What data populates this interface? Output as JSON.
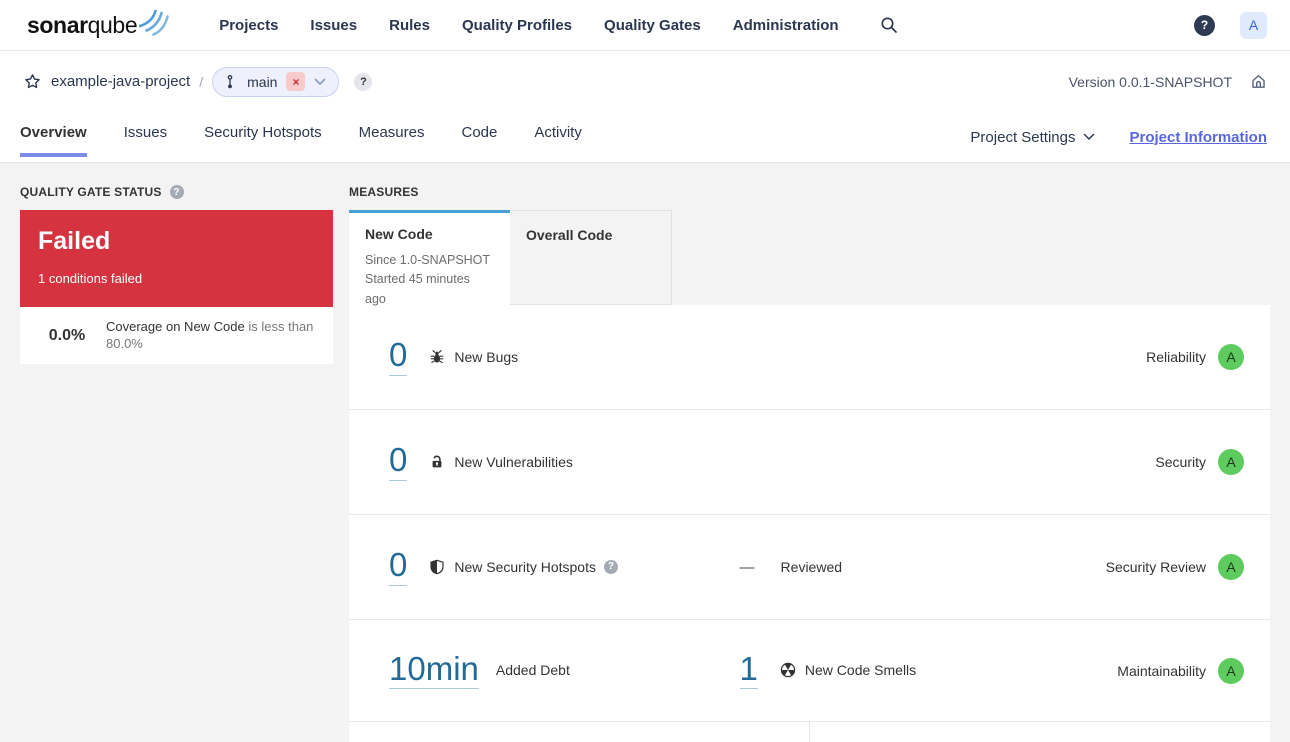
{
  "brand": {
    "name_bold": "sonar",
    "name_rest": "qube"
  },
  "nav": {
    "items": [
      "Projects",
      "Issues",
      "Rules",
      "Quality Profiles",
      "Quality Gates",
      "Administration"
    ],
    "help_glyph": "?",
    "avatar_initial": "A"
  },
  "breadcrumb": {
    "project": "example-java-project",
    "separator": "/",
    "branch_name": "main",
    "remove_glyph": "×",
    "help_glyph": "?",
    "version_label": "Version 0.0.1-SNAPSHOT"
  },
  "tabs": {
    "items": [
      "Overview",
      "Issues",
      "Security Hotspots",
      "Measures",
      "Code",
      "Activity"
    ],
    "active": "Overview",
    "project_settings_label": "Project Settings",
    "project_information_label": "Project Information"
  },
  "quality_gate": {
    "section_title": "QUALITY GATE STATUS",
    "help_glyph": "?",
    "status": "Failed",
    "conditions_summary": "1 conditions failed",
    "condition": {
      "value": "0.0%",
      "metric": "Coverage on New Code",
      "rule": "is less than 80.0%"
    }
  },
  "measures": {
    "section_title": "MEASURES",
    "new_code_tab": {
      "label": "New Code",
      "since": "Since 1.0-SNAPSHOT",
      "started": "Started 45 minutes ago"
    },
    "overall_code_tab": {
      "label": "Overall Code"
    },
    "rows": [
      {
        "value": "0",
        "label": "New Bugs",
        "domain": "Reliability",
        "rating": "A"
      },
      {
        "value": "0",
        "label": "New Vulnerabilities",
        "domain": "Security",
        "rating": "A"
      },
      {
        "value": "0",
        "label": "New Security Hotspots",
        "help_glyph": "?",
        "reviewed_dash": "—",
        "reviewed_label": "Reviewed",
        "domain": "Security Review",
        "rating": "A"
      },
      {
        "value": "10min",
        "label": "Added Debt",
        "smells_value": "1",
        "smells_label": "New Code Smells",
        "domain": "Maintainability",
        "rating": "A"
      }
    ]
  },
  "icons": {
    "search": "magnifier",
    "help": "question-circle",
    "star": "star-outline",
    "branch": "git-branch",
    "chevron": "chevron-down",
    "home": "house-outline",
    "bug": "bug",
    "vulnerability": "open-lock",
    "hotspot": "half-shield",
    "code_smell": "segmented-wheel"
  },
  "colors": {
    "accent_indigo": "#5867dd",
    "link_blue": "#236a97",
    "new_code_tab_blue": "#4b9fd5",
    "failed_red": "#d4333f",
    "rating_a_green": "#5ecb5e",
    "page_background": "#f3f3f3",
    "navbar_text": "#2b3750"
  }
}
